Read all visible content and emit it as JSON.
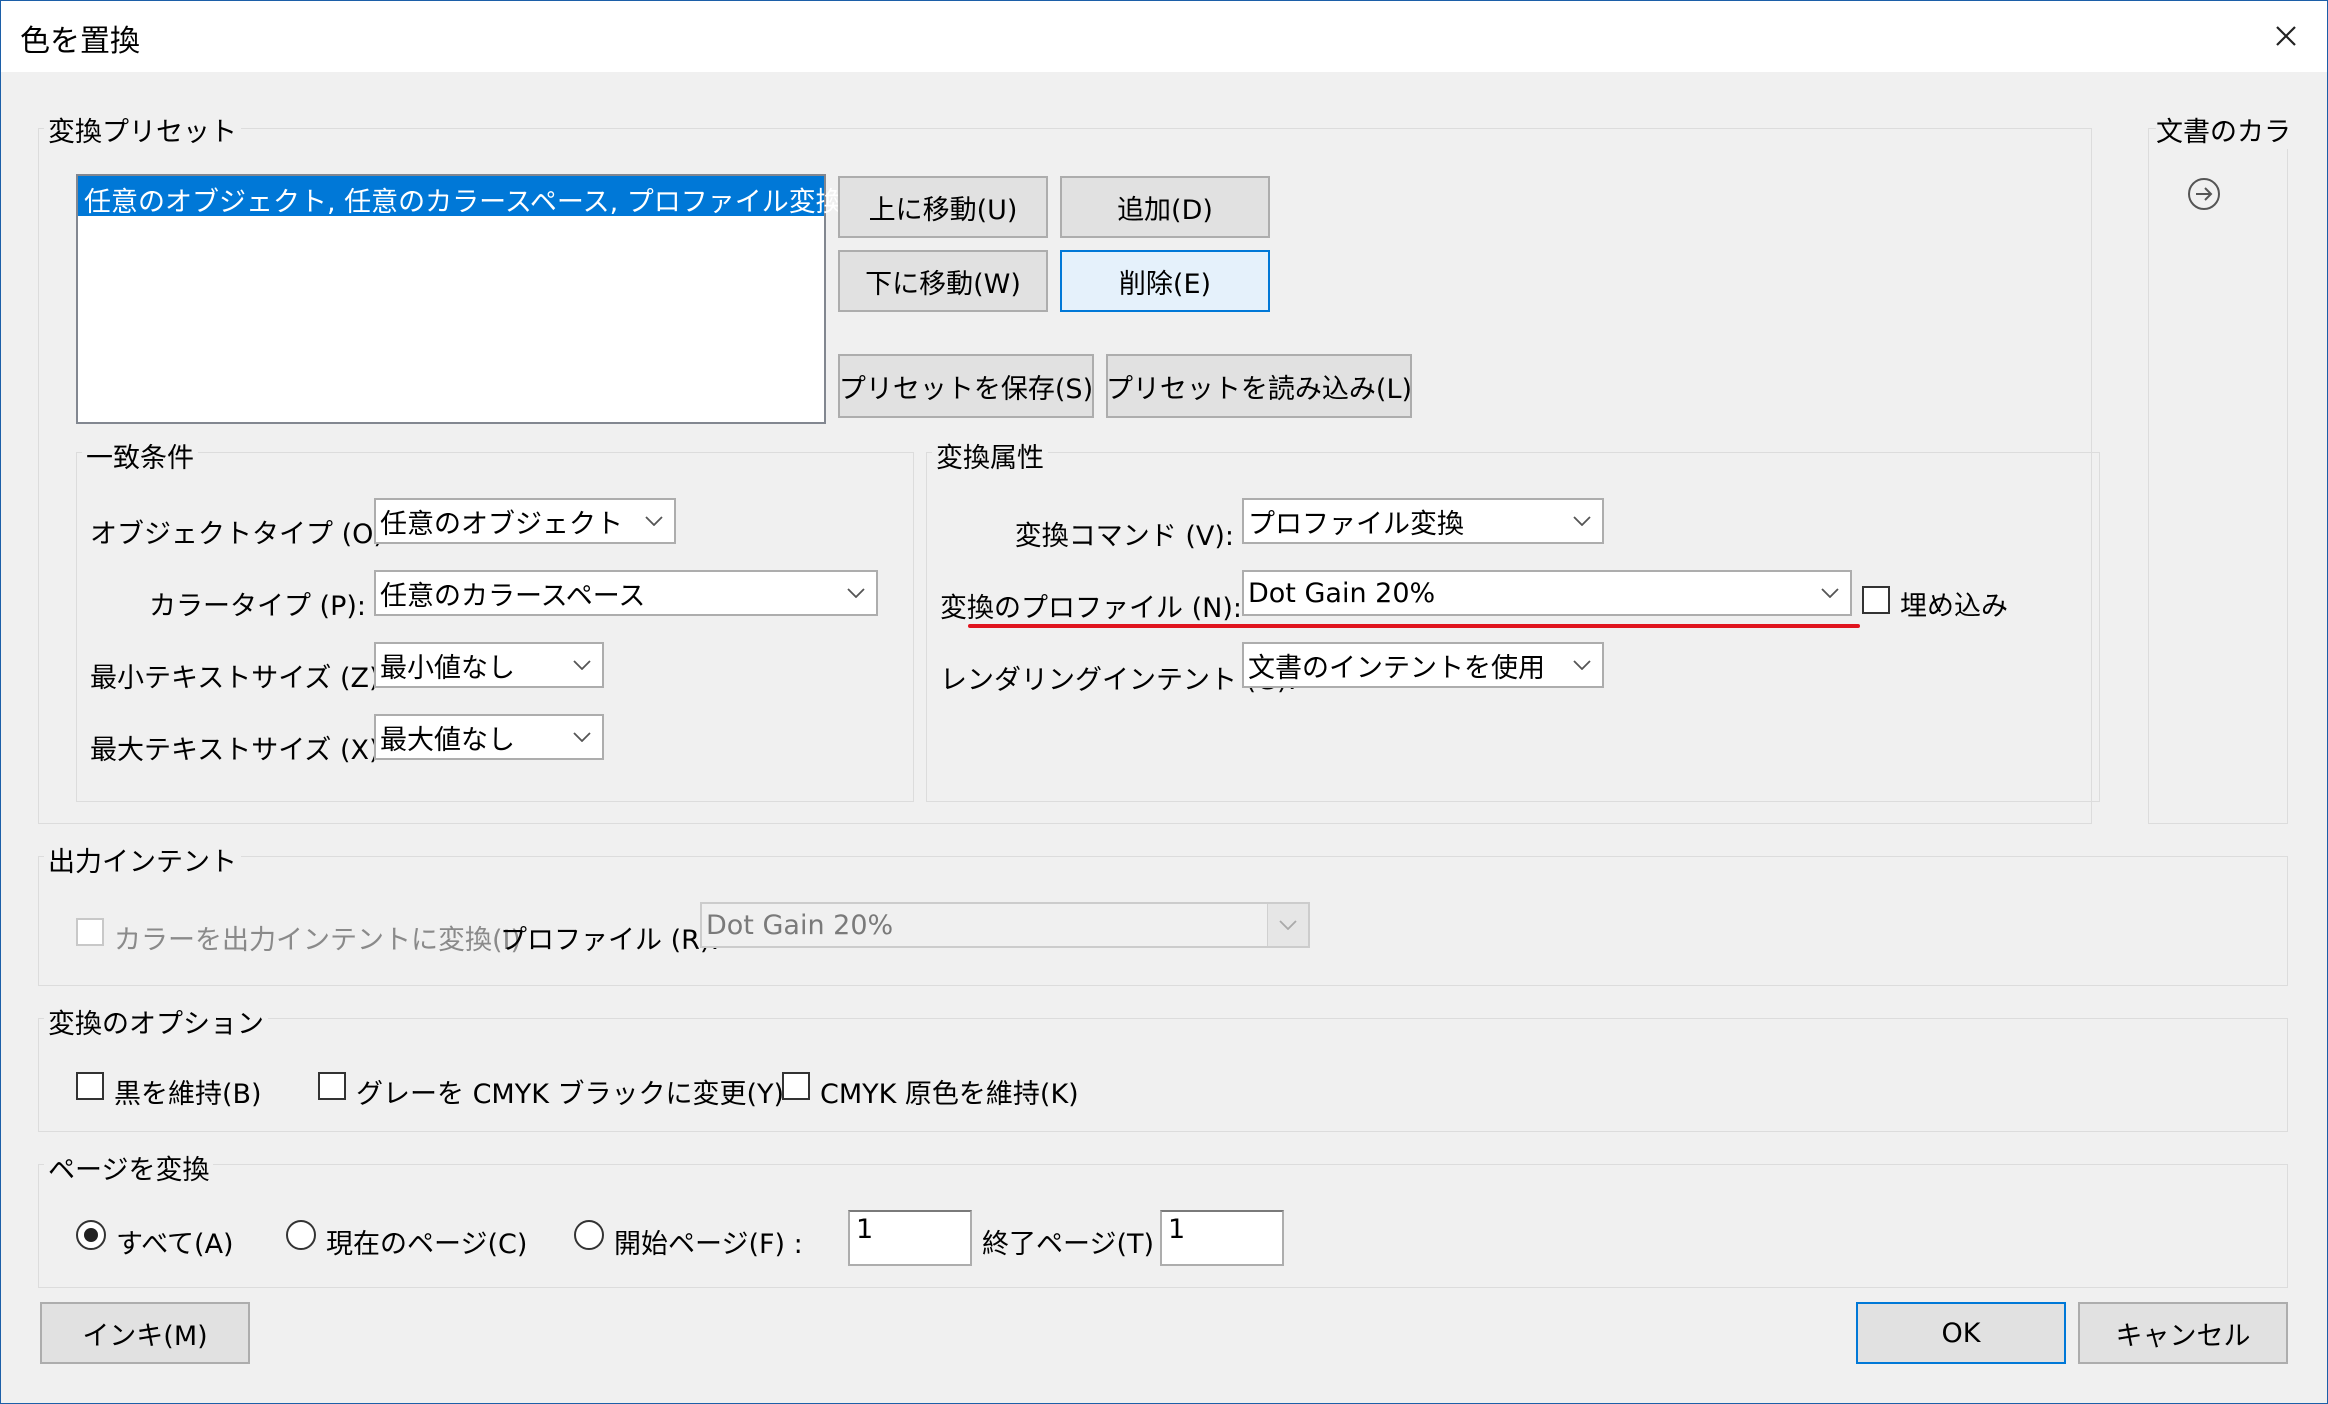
{
  "window": {
    "title": "色を置換",
    "close_icon": "close-icon"
  },
  "presets": {
    "group_label": "変換プリセット",
    "items": [
      "任意のオブジェクト, 任意のカラースペース, プロファイル変換"
    ],
    "move_up": "上に移動(U)",
    "add": "追加(D)",
    "move_down": "下に移動(W)",
    "delete": "削除(E)",
    "save": "プリセットを保存(S)",
    "load": "プリセットを読み込み(L)"
  },
  "document_colors": {
    "label": "文書のカラー",
    "icon": "arrow-right-circle-icon"
  },
  "match": {
    "group_label": "一致条件",
    "object_type_label": "オブジェクトタイプ (O):",
    "object_type_value": "任意のオブジェクト",
    "color_type_label": "カラータイプ (P):",
    "color_type_value": "任意のカラースペース",
    "min_text_label": "最小テキストサイズ (Z):",
    "min_text_value": "最小値なし",
    "max_text_label": "最大テキストサイズ (X):",
    "max_text_value": "最大値なし"
  },
  "conversion": {
    "group_label": "変換属性",
    "command_label": "変換コマンド (V):",
    "command_value": "プロファイル変換",
    "profile_label": "変換のプロファイル (N):",
    "profile_value": "Dot Gain 20%",
    "embed_label": "埋め込み",
    "intent_label": "レンダリングインテント (G):",
    "intent_value": "文書のインテントを使用",
    "highlight_color": "#e0141e"
  },
  "output_intent": {
    "group_label": "出力インテント",
    "convert_label": "カラーを出力インテントに変換(I)",
    "profile_label": "プロファイル (R):",
    "profile_value": "Dot Gain 20%"
  },
  "options": {
    "group_label": "変換のオプション",
    "keep_black": "黒を維持(B)",
    "gray_to_cmyk": "グレーを CMYK ブラックに変更(Y)",
    "keep_cmyk": "CMYK 原色を維持(K)"
  },
  "pages": {
    "group_label": "ページを変換",
    "all": "すべて(A)",
    "current": "現在のページ(C)",
    "from_label": "開始ページ(F) :",
    "from_value": "1",
    "to_label": "終了ページ(T) :",
    "to_value": "1"
  },
  "footer": {
    "ink": "インキ(M)",
    "ok": "OK",
    "cancel": "キャンセル"
  },
  "colors": {
    "selection": "#0078d7",
    "accent_border": "#0078d7"
  }
}
